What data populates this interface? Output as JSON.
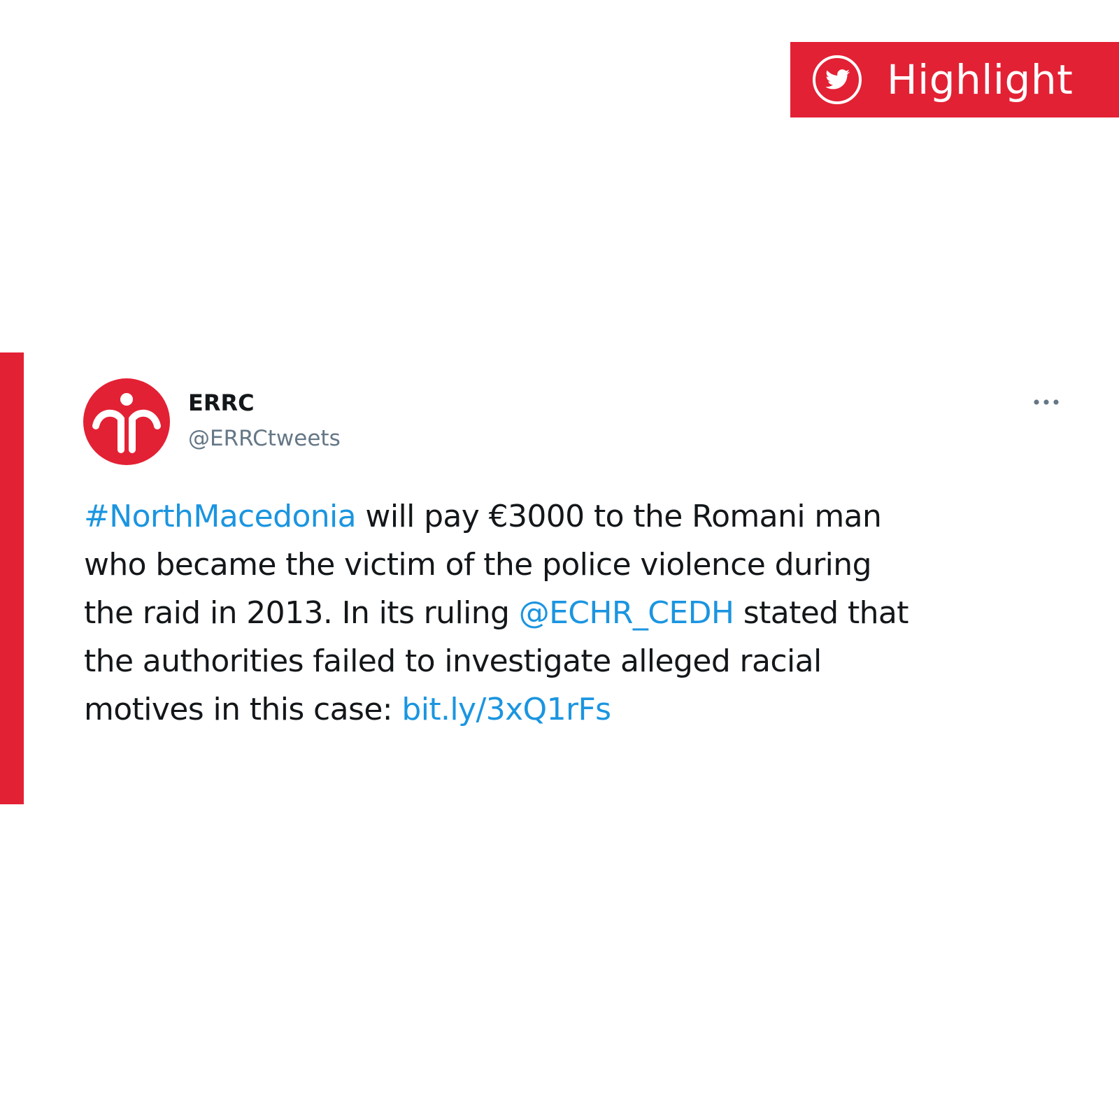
{
  "badge": {
    "label": "Highlight",
    "icon": "twitter-bird-icon",
    "background_color": "#e32134"
  },
  "tweet": {
    "author": {
      "display_name": "ERRC",
      "handle": "@ERRCtweets",
      "avatar_icon": "errc-logo-icon"
    },
    "more_icon": "more-options-icon",
    "lines": [
      [
        {
          "text": "#NorthMacedonia",
          "type": "hashtag"
        },
        {
          "text": " will pay €3000 to the Romani man",
          "type": "text"
        }
      ],
      [
        {
          "text": "who became the victim of the police violence during",
          "type": "text"
        }
      ],
      [
        {
          "text": "the raid in 2013. In its ruling ",
          "type": "text"
        },
        {
          "text": "@ECHR_CEDH",
          "type": "mention"
        },
        {
          "text": " stated that",
          "type": "text"
        }
      ],
      [
        {
          "text": "the authorities failed to investigate alleged racial",
          "type": "text"
        }
      ],
      [
        {
          "text": "motives in this case: ",
          "type": "text"
        },
        {
          "text": "bit.ly/3xQ1rFs",
          "type": "url"
        }
      ]
    ]
  },
  "colors": {
    "accent": "#e32134",
    "link": "#1b95e0",
    "text": "#14171a",
    "secondary_text": "#657786"
  }
}
